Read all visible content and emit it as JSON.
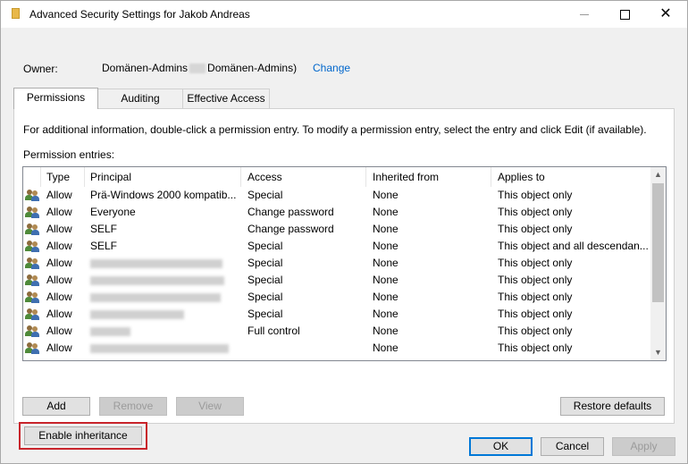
{
  "window": {
    "title": "Advanced Security Settings for Jakob Andreas",
    "minimize": "–",
    "maximize": "□",
    "close": "✕"
  },
  "owner": {
    "label": "Owner:",
    "value_prefix": "Domänen-Admins",
    "value_suffix": "Domänen-Admins)",
    "change_link": "Change"
  },
  "tabs": [
    {
      "label": "Permissions",
      "active": true
    },
    {
      "label": "Auditing",
      "active": false
    },
    {
      "label": "Effective Access",
      "active": false
    }
  ],
  "permissions": {
    "info": "For additional information, double-click a permission entry. To modify a permission entry, select the entry and click Edit (if available).",
    "entries_label": "Permission entries:",
    "columns": [
      "Type",
      "Principal",
      "Access",
      "Inherited from",
      "Applies to"
    ],
    "rows": [
      {
        "type": "Allow",
        "principal": "Prä-Windows 2000 kompatib...",
        "access": "Special",
        "inherited": "None",
        "applies": "This object only"
      },
      {
        "type": "Allow",
        "principal": "Everyone",
        "access": "Change password",
        "inherited": "None",
        "applies": "This object only"
      },
      {
        "type": "Allow",
        "principal": "SELF",
        "access": "Change password",
        "inherited": "None",
        "applies": "This object only"
      },
      {
        "type": "Allow",
        "principal": "SELF",
        "access": "Special",
        "inherited": "None",
        "applies": "This object and all descendan..."
      },
      {
        "type": "Allow",
        "principal": "",
        "access": "Special",
        "inherited": "None",
        "applies": "This object only"
      },
      {
        "type": "Allow",
        "principal": "",
        "access": "Special",
        "inherited": "None",
        "applies": "This object only"
      },
      {
        "type": "Allow",
        "principal": "",
        "access": "Special",
        "inherited": "None",
        "applies": "This object only"
      },
      {
        "type": "Allow",
        "principal": "",
        "access": "Special",
        "inherited": "None",
        "applies": "This object only"
      },
      {
        "type": "Allow",
        "principal": "",
        "access": "Full control",
        "inherited": "None",
        "applies": "This object only"
      },
      {
        "type": "Allow",
        "principal": "",
        "access": "",
        "inherited": "None",
        "applies": "This object only"
      }
    ]
  },
  "buttons": {
    "add": "Add",
    "remove": "Remove",
    "view": "View",
    "restore_defaults": "Restore defaults",
    "enable_inheritance": "Enable inheritance",
    "ok": "OK",
    "cancel": "Cancel",
    "apply": "Apply"
  },
  "colors": {
    "highlight": "#c8242b",
    "link": "#0066cc"
  }
}
